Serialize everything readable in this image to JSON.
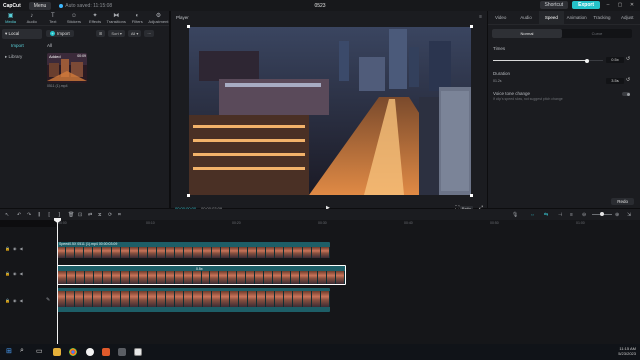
{
  "titlebar": {
    "app_name": "CapCut",
    "menu_label": "Menu",
    "autosave": "Auto saved: 11:15:08",
    "project_title": "0523",
    "shortcut_label": "Shortcut",
    "export_label": "Export"
  },
  "media": {
    "tabs": [
      {
        "label": "Media",
        "icon": "media-icon"
      },
      {
        "label": "Audio",
        "icon": "audio-icon"
      },
      {
        "label": "Text",
        "icon": "text-icon"
      },
      {
        "label": "Stickers",
        "icon": "stickers-icon"
      },
      {
        "label": "Effects",
        "icon": "effects-icon"
      },
      {
        "label": "Transitions",
        "icon": "transitions-icon"
      },
      {
        "label": "Filters",
        "icon": "filters-icon"
      },
      {
        "label": "Adjustment",
        "icon": "adjustment-icon"
      }
    ],
    "nav": [
      "Local",
      "Import",
      "Library"
    ],
    "import_label": "Import",
    "sort_label": "Sort",
    "all_filter": "All",
    "all_label": "All",
    "thumb_added": "Added",
    "thumb_duration": "00:09",
    "thumb_name": "0511 (1).mp4"
  },
  "player": {
    "label": "Player",
    "current_time": "00:00:00:00",
    "total_time": "00:00:03:09",
    "ratio_label": "Ratio"
  },
  "properties": {
    "tabs": [
      "Video",
      "Audio",
      "Speed",
      "Animation",
      "Tracking",
      "Adjust"
    ],
    "active_tab": "Speed",
    "modes": [
      "Normal",
      "Curve"
    ],
    "times_label": "Times",
    "times_value": "0.5x",
    "times_fraction": 0.85,
    "duration_label": "Duration",
    "duration_left": "01.2s",
    "duration_value": "3.5s",
    "voice_label": "Voice tone change",
    "voice_note": "If clip's speed slow, not suggest pitch change",
    "redo_label": "Redo"
  },
  "timeline": {
    "ruler": [
      "00:00",
      "00:10",
      "00:20",
      "00:30",
      "00:40",
      "00:50",
      "01:00"
    ],
    "tracks": [
      {
        "label": "Speed0.5X  0511 (1).mp4  00:00:03:09"
      },
      {
        "label": "0.5x",
        "speed": "0.5x"
      },
      {
        "label": ""
      }
    ]
  },
  "taskbar": {
    "time": "11:15 AM",
    "date": "5/23/2023"
  }
}
